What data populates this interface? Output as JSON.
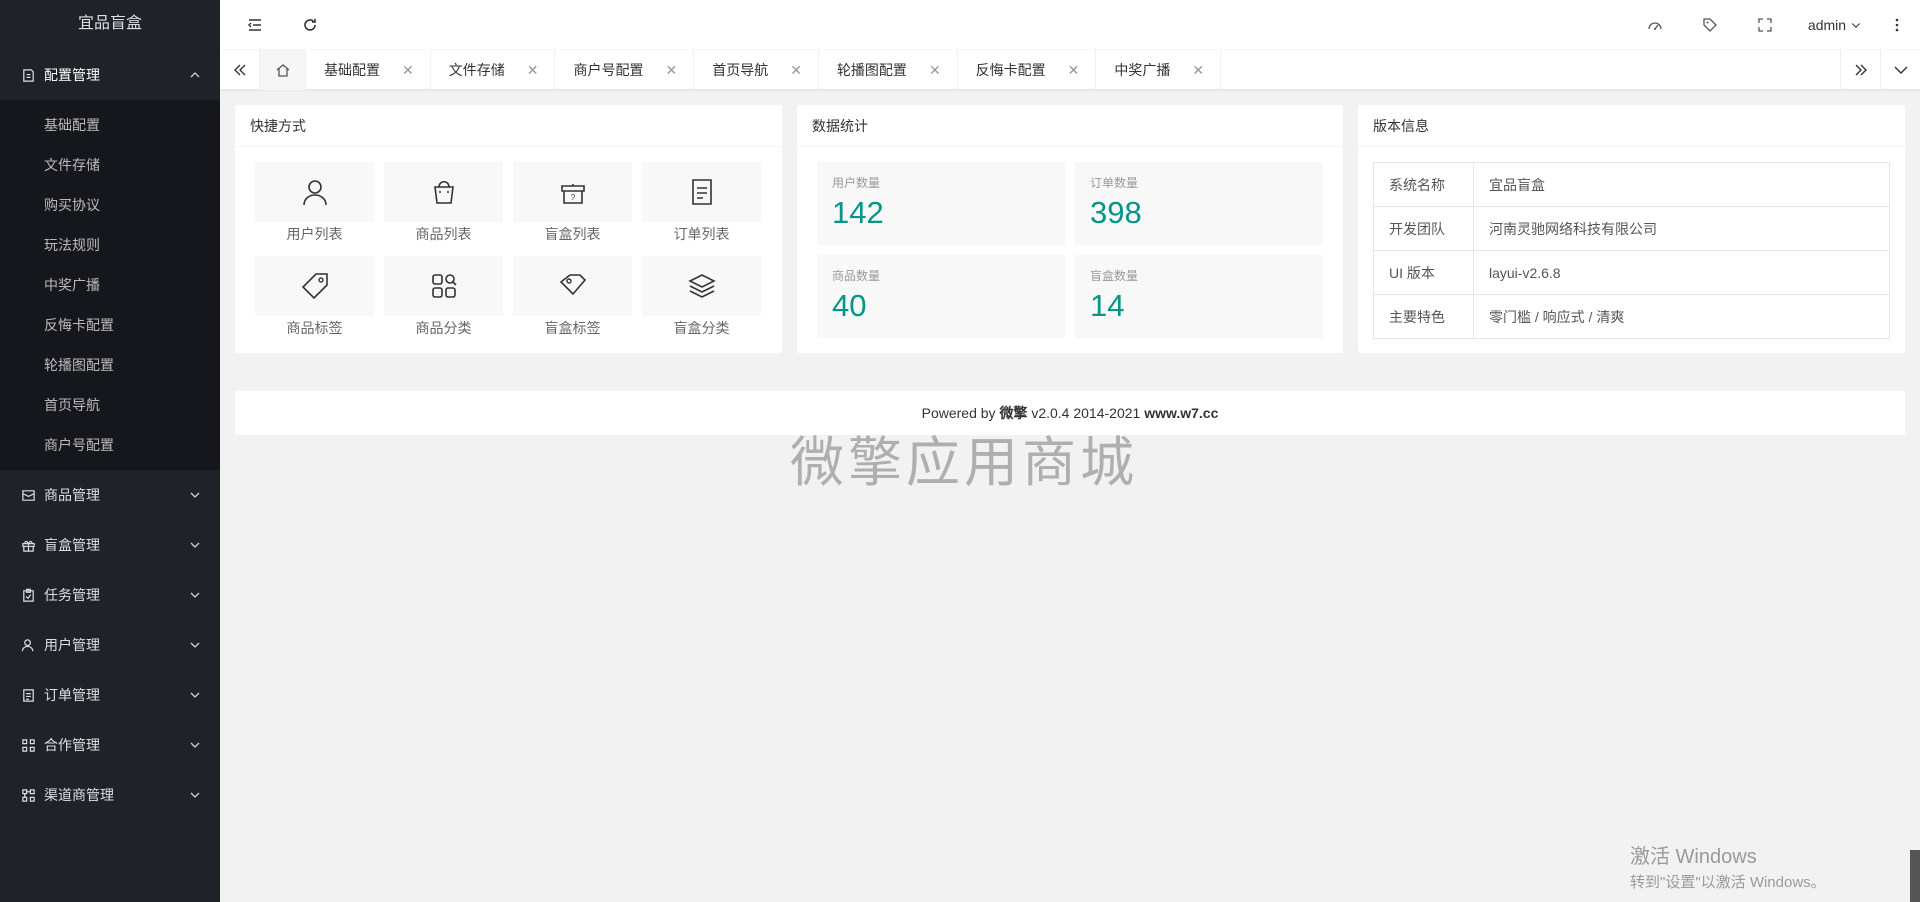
{
  "app": {
    "title": "宜品盲盒"
  },
  "sidebar": {
    "groups": [
      {
        "label": "配置管理",
        "icon": "config-icon",
        "open": true,
        "items": [
          "基础配置",
          "文件存储",
          "购买协议",
          "玩法规则",
          "中奖广播",
          "反悔卡配置",
          "轮播图配置",
          "首页导航",
          "商户号配置"
        ]
      },
      {
        "label": "商品管理",
        "icon": "goods-icon"
      },
      {
        "label": "盲盒管理",
        "icon": "gift-icon"
      },
      {
        "label": "任务管理",
        "icon": "task-icon"
      },
      {
        "label": "用户管理",
        "icon": "user-icon"
      },
      {
        "label": "订单管理",
        "icon": "order-icon"
      },
      {
        "label": "合作管理",
        "icon": "cooperate-icon"
      },
      {
        "label": "渠道商管理",
        "icon": "channel-icon"
      }
    ]
  },
  "header": {
    "user": "admin"
  },
  "tabs": [
    {
      "label": "基础配置"
    },
    {
      "label": "文件存储"
    },
    {
      "label": "商户号配置"
    },
    {
      "label": "首页导航"
    },
    {
      "label": "轮播图配置"
    },
    {
      "label": "反悔卡配置"
    },
    {
      "label": "中奖广播"
    }
  ],
  "shortcuts": {
    "title": "快捷方式",
    "items": [
      {
        "label": "用户列表",
        "icon": "user-icon"
      },
      {
        "label": "商品列表",
        "icon": "shopping-bag-icon"
      },
      {
        "label": "盲盒列表",
        "icon": "mystery-box-icon"
      },
      {
        "label": "订单列表",
        "icon": "document-icon"
      },
      {
        "label": "商品标签",
        "icon": "tag-icon"
      },
      {
        "label": "商品分类",
        "icon": "category-icon"
      },
      {
        "label": "盲盒标签",
        "icon": "tags-icon"
      },
      {
        "label": "盲盒分类",
        "icon": "layers-icon"
      }
    ]
  },
  "stats": {
    "title": "数据统计",
    "items": [
      {
        "label": "用户数量",
        "value": "142"
      },
      {
        "label": "订单数量",
        "value": "398"
      },
      {
        "label": "商品数量",
        "value": "40"
      },
      {
        "label": "盲盒数量",
        "value": "14"
      }
    ]
  },
  "version": {
    "title": "版本信息",
    "rows": [
      {
        "key": "系统名称",
        "value": "宜品盲盒"
      },
      {
        "key": "开发团队",
        "value": "河南灵驰网络科技有限公司"
      },
      {
        "key": "UI 版本",
        "value": "layui-v2.6.8"
      },
      {
        "key": "主要特色",
        "value": "零门槛 / 响应式 / 清爽"
      }
    ]
  },
  "footer": {
    "powered": "Powered by",
    "brand": "微擎",
    "version": "v2.0.4 2014-2021",
    "site": "www.w7.cc"
  },
  "watermark": "微擎应用商城",
  "activation": {
    "line1": "激活 Windows",
    "line2": "转到\"设置\"以激活 Windows。"
  },
  "colors": {
    "accent": "#009688",
    "sidebar": "#20222a"
  }
}
